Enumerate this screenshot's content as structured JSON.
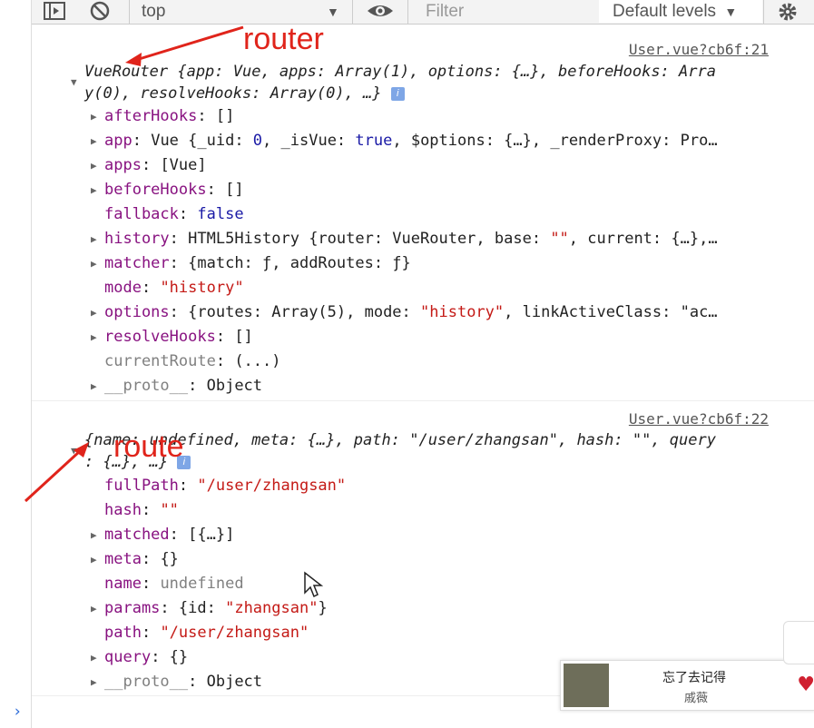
{
  "toolbar": {
    "context": "top",
    "filter_placeholder": "Filter",
    "levels": "Default levels"
  },
  "annotations": {
    "router": "router",
    "route": "route"
  },
  "msg1": {
    "source": "User.vue?cb6f:21",
    "summary_l1": "VueRouter {app: Vue, apps: Array(1), options: {…}, beforeHooks: Arra",
    "summary_l2": "y(0), resolveHooks: Array(0), …}",
    "props": [
      {
        "key": "afterHooks",
        "val": "[]"
      },
      {
        "key": "app",
        "val": "Vue {_uid: 0, _isVue: true, $options: {…}, _renderProxy: Pro…"
      },
      {
        "key": "apps",
        "val": "[Vue]"
      },
      {
        "key": "beforeHooks",
        "val": "[]"
      },
      {
        "key": "fallback",
        "val": "false"
      },
      {
        "key": "history",
        "val": "HTML5History {router: VueRouter, base: \"\", current: {…},…"
      },
      {
        "key": "matcher",
        "val": "{match: ƒ, addRoutes: ƒ}"
      },
      {
        "key": "mode",
        "val": "\"history\""
      },
      {
        "key": "options",
        "val": "{routes: Array(5), mode: \"history\", linkActiveClass: \"ac…"
      },
      {
        "key": "resolveHooks",
        "val": "[]"
      },
      {
        "key": "currentRoute",
        "val": "(...)"
      },
      {
        "key": "__proto__",
        "val": "Object"
      }
    ]
  },
  "msg2": {
    "source": "User.vue?cb6f:22",
    "summary_l1": "{name: undefined, meta: {…}, path: \"/user/zhangsan\", hash: \"\", query",
    "summary_l2": ": {…}, …}",
    "props": [
      {
        "key": "fullPath",
        "val": "\"/user/zhangsan\""
      },
      {
        "key": "hash",
        "val": "\"\""
      },
      {
        "key": "matched",
        "val": "[{…}]"
      },
      {
        "key": "meta",
        "val": "{}"
      },
      {
        "key": "name",
        "val": "undefined"
      },
      {
        "key": "params",
        "val": "{id: \"zhangsan\"}"
      },
      {
        "key": "path",
        "val": "\"/user/zhangsan\""
      },
      {
        "key": "query",
        "val": "{}"
      },
      {
        "key": "__proto__",
        "val": "Object"
      }
    ]
  },
  "popup": {
    "title": "忘了去记得",
    "artist": "戚薇"
  },
  "colors": {
    "annotation": "#e0241b",
    "key": "#881280",
    "string": "#c41a16",
    "keyword": "#1a1aa6"
  }
}
